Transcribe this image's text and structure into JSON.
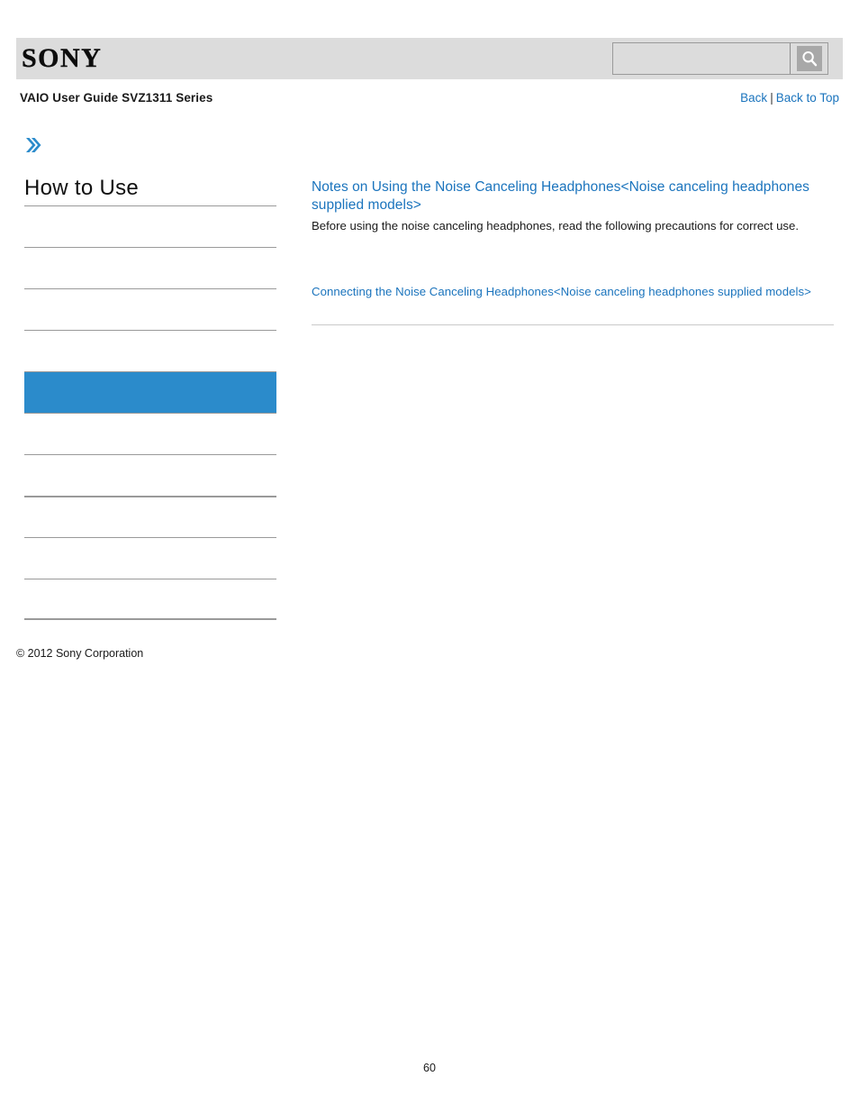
{
  "header": {
    "logo_text": "SONY",
    "logo_icon": "sony-wordmark",
    "search": {
      "value": "",
      "placeholder": "",
      "button_icon": "search-icon",
      "button_label": "Search"
    }
  },
  "titlebar": {
    "guide_title": "VAIO User Guide SVZ1311 Series",
    "nav": {
      "back_label": "Back",
      "separator": "|",
      "back_to_top_label": "Back to Top"
    }
  },
  "sidebar": {
    "breadcrumb_icon": "double-chevron-right-icon",
    "heading": "How to Use",
    "items": [
      {
        "label": "",
        "selected": false,
        "thick": false
      },
      {
        "label": "",
        "selected": false,
        "thick": false
      },
      {
        "label": "",
        "selected": false,
        "thick": false
      },
      {
        "label": "",
        "selected": false,
        "thick": false
      },
      {
        "label": "",
        "selected": true,
        "thick": false
      },
      {
        "label": "",
        "selected": false,
        "thick": false
      },
      {
        "label": "",
        "selected": false,
        "thick": false
      },
      {
        "label": "",
        "selected": false,
        "thick": true
      },
      {
        "label": "",
        "selected": false,
        "thick": false
      },
      {
        "label": "",
        "selected": false,
        "thick": false
      }
    ],
    "copyright": "© 2012 Sony Corporation"
  },
  "main": {
    "entries": [
      {
        "link": "Notes on Using the Noise Canceling Headphones<Noise canceling headphones supplied models>",
        "description": "Before using the noise canceling headphones, read the following precautions for correct use."
      },
      {
        "link": "Connecting the Noise Canceling Headphones<Noise canceling headphones supplied models>",
        "description": ""
      }
    ]
  },
  "footer": {
    "page_number": "60"
  },
  "colors": {
    "accent_blue": "#2b8bcb",
    "link_blue": "#1b74bd",
    "header_gray": "#dcdcdc",
    "rule_gray": "#9a9a9a"
  }
}
